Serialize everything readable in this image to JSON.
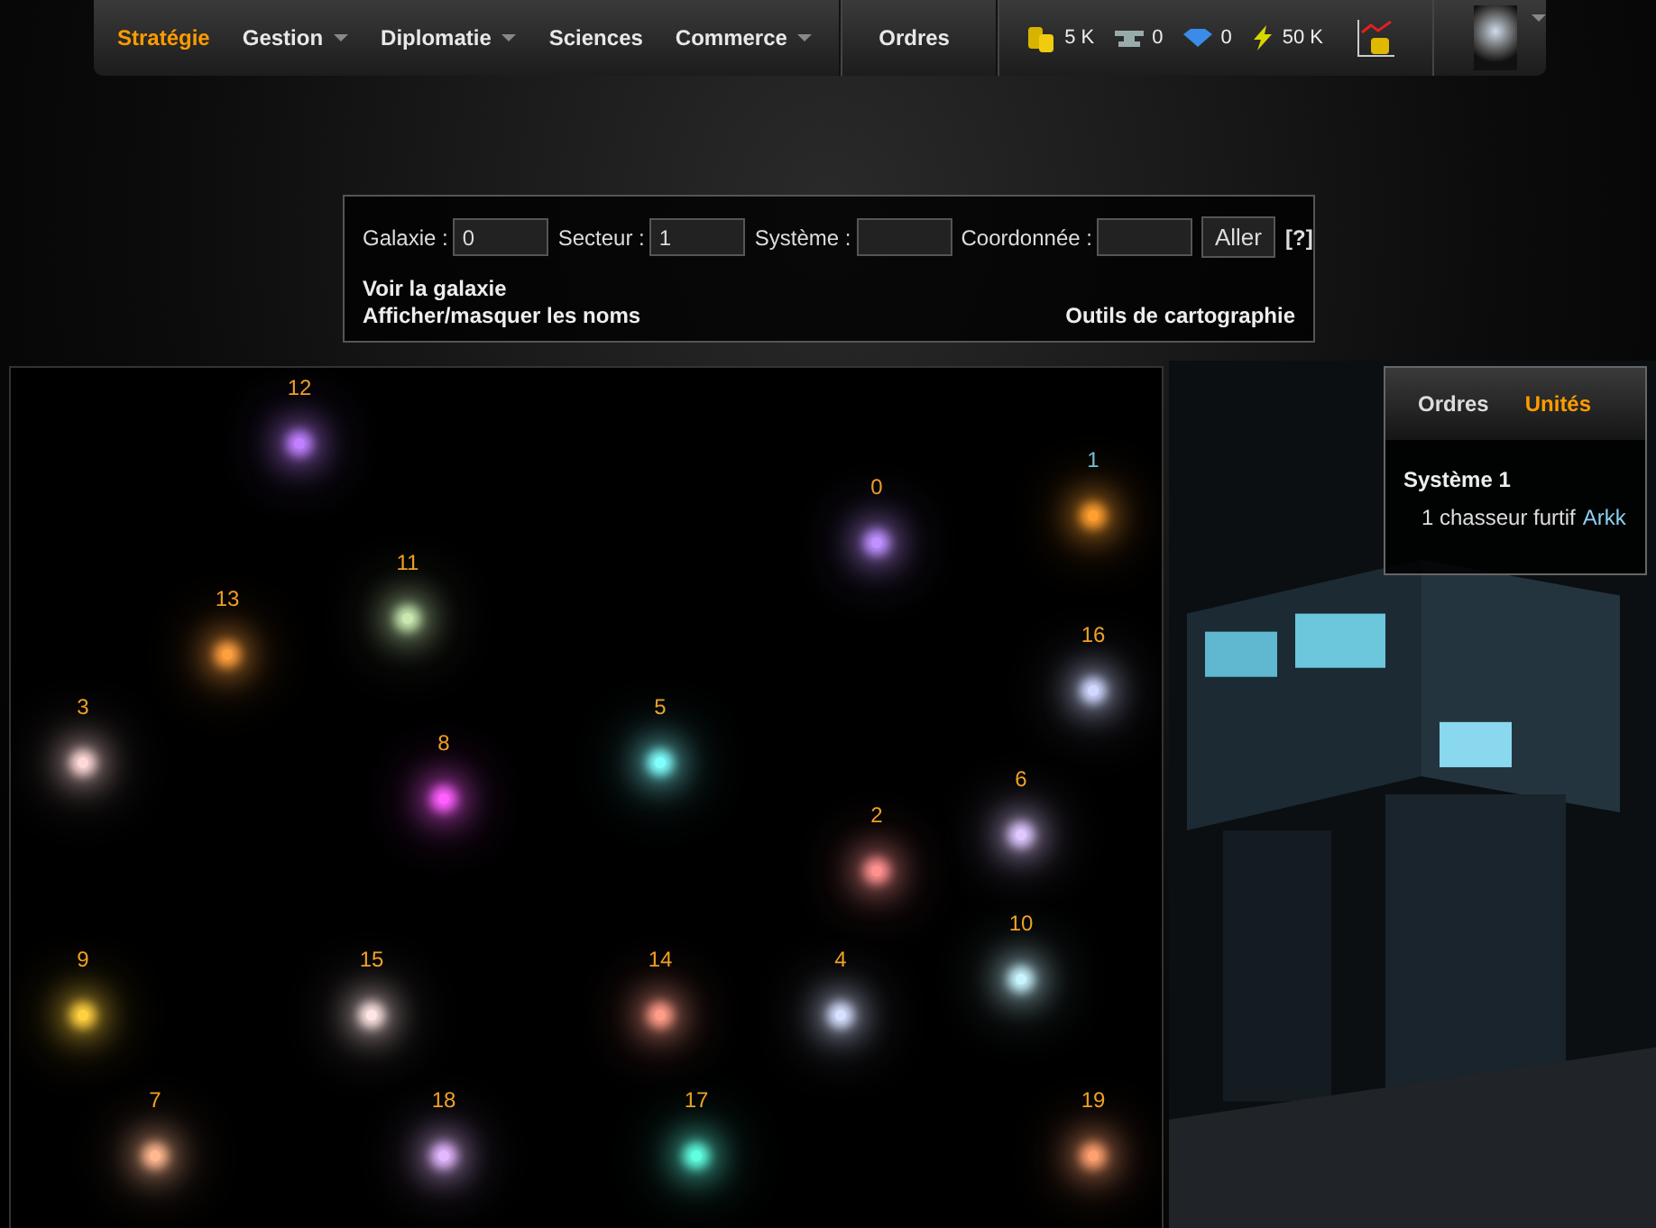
{
  "nav": {
    "items": [
      {
        "label": "Stratégie",
        "selected": true,
        "has_menu": false
      },
      {
        "label": "Gestion",
        "selected": false,
        "has_menu": true
      },
      {
        "label": "Diplomatie",
        "selected": false,
        "has_menu": true
      },
      {
        "label": "Sciences",
        "selected": false,
        "has_menu": false
      },
      {
        "label": "Commerce",
        "selected": false,
        "has_menu": true
      }
    ],
    "orders": "Ordres",
    "resources": [
      {
        "kind": "credits",
        "value": "5 K"
      },
      {
        "kind": "ore",
        "value": "0"
      },
      {
        "kind": "crystal",
        "value": "0"
      },
      {
        "kind": "energy",
        "value": "50 K"
      }
    ]
  },
  "search": {
    "fields": [
      {
        "label": "Galaxie :",
        "value": "0"
      },
      {
        "label": "Secteur :",
        "value": "1"
      },
      {
        "label": "Système :"
      },
      {
        "label": "Coordonnée :"
      }
    ],
    "go_button": "Aller",
    "help_link": "[?]",
    "links": [
      "Voir la galaxie",
      "Afficher/masquer les noms"
    ],
    "tools_link": "Outils de cartographie"
  },
  "map": {
    "systems": [
      {
        "label": "12",
        "color": "#c080ff",
        "selected": false
      },
      {
        "label": "1",
        "color": "#ffa030",
        "selected": true
      },
      {
        "label": "0",
        "color": "#c090ff",
        "selected": false
      },
      {
        "label": "11",
        "color": "#c8e8b0",
        "selected": false
      },
      {
        "label": "13",
        "color": "#ffa040",
        "selected": false
      },
      {
        "label": "16",
        "color": "#d0d8ff",
        "selected": false
      },
      {
        "label": "3",
        "color": "#ffd8d8",
        "selected": false
      },
      {
        "label": "5",
        "color": "#80ffff",
        "selected": false
      },
      {
        "label": "8",
        "color": "#ff60ff",
        "selected": false
      },
      {
        "label": "6",
        "color": "#e0c8ff",
        "selected": false
      },
      {
        "label": "2",
        "color": "#ff9090",
        "selected": false
      },
      {
        "label": "10",
        "color": "#c8f4ff",
        "selected": false
      },
      {
        "label": "9",
        "color": "#ffd040",
        "selected": false
      },
      {
        "label": "15",
        "color": "#ffe4e4",
        "selected": false
      },
      {
        "label": "14",
        "color": "#ff9c88",
        "selected": false
      },
      {
        "label": "4",
        "color": "#d8e0ff",
        "selected": false
      },
      {
        "label": "7",
        "color": "#ffb890",
        "selected": false
      },
      {
        "label": "18",
        "color": "#e4b8ff",
        "selected": false
      },
      {
        "label": "17",
        "color": "#60ffe0",
        "selected": false
      },
      {
        "label": "19",
        "color": "#ffa070",
        "selected": false
      }
    ]
  },
  "side_panel": {
    "tabs": [
      {
        "label": "Ordres",
        "selected": false
      },
      {
        "label": "Unités",
        "selected": true
      }
    ],
    "system_title": "Système 1",
    "unit": {
      "text": "1 chasseur furtif",
      "owner": "Arkk"
    }
  }
}
